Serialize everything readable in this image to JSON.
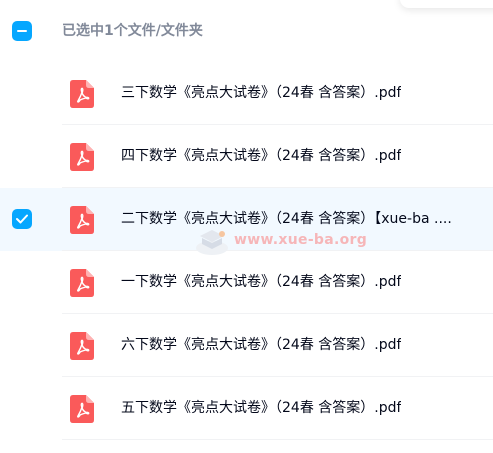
{
  "header": {
    "selected_text": "已选中1个文件/文件夹"
  },
  "files": [
    {
      "name": "三下数学《亮点大试卷》（24春 含答案）.pdf",
      "selected": false,
      "icon": "pdf-icon"
    },
    {
      "name": "四下数学《亮点大试卷》（24春 含答案）.pdf",
      "selected": false,
      "icon": "pdf-icon"
    },
    {
      "name": "二下数学《亮点大试卷》（24春 含答案）【xue-ba ....",
      "selected": true,
      "icon": "pdf-icon"
    },
    {
      "name": "一下数学《亮点大试卷》（24春 含答案）.pdf",
      "selected": false,
      "icon": "pdf-icon"
    },
    {
      "name": "六下数学《亮点大试卷》（24春 含答案）.pdf",
      "selected": false,
      "icon": "pdf-icon"
    },
    {
      "name": "五下数学《亮点大试卷》（24春 含答案）.pdf",
      "selected": false,
      "icon": "pdf-icon"
    }
  ],
  "watermark": {
    "text": "www.xue-ba.org"
  },
  "colors": {
    "accent": "#06a7ff",
    "pdf_icon": "#fa5a5a",
    "selected_row_bg": "#f2f9ff",
    "text_primary": "#03081a",
    "text_secondary": "#818999"
  }
}
